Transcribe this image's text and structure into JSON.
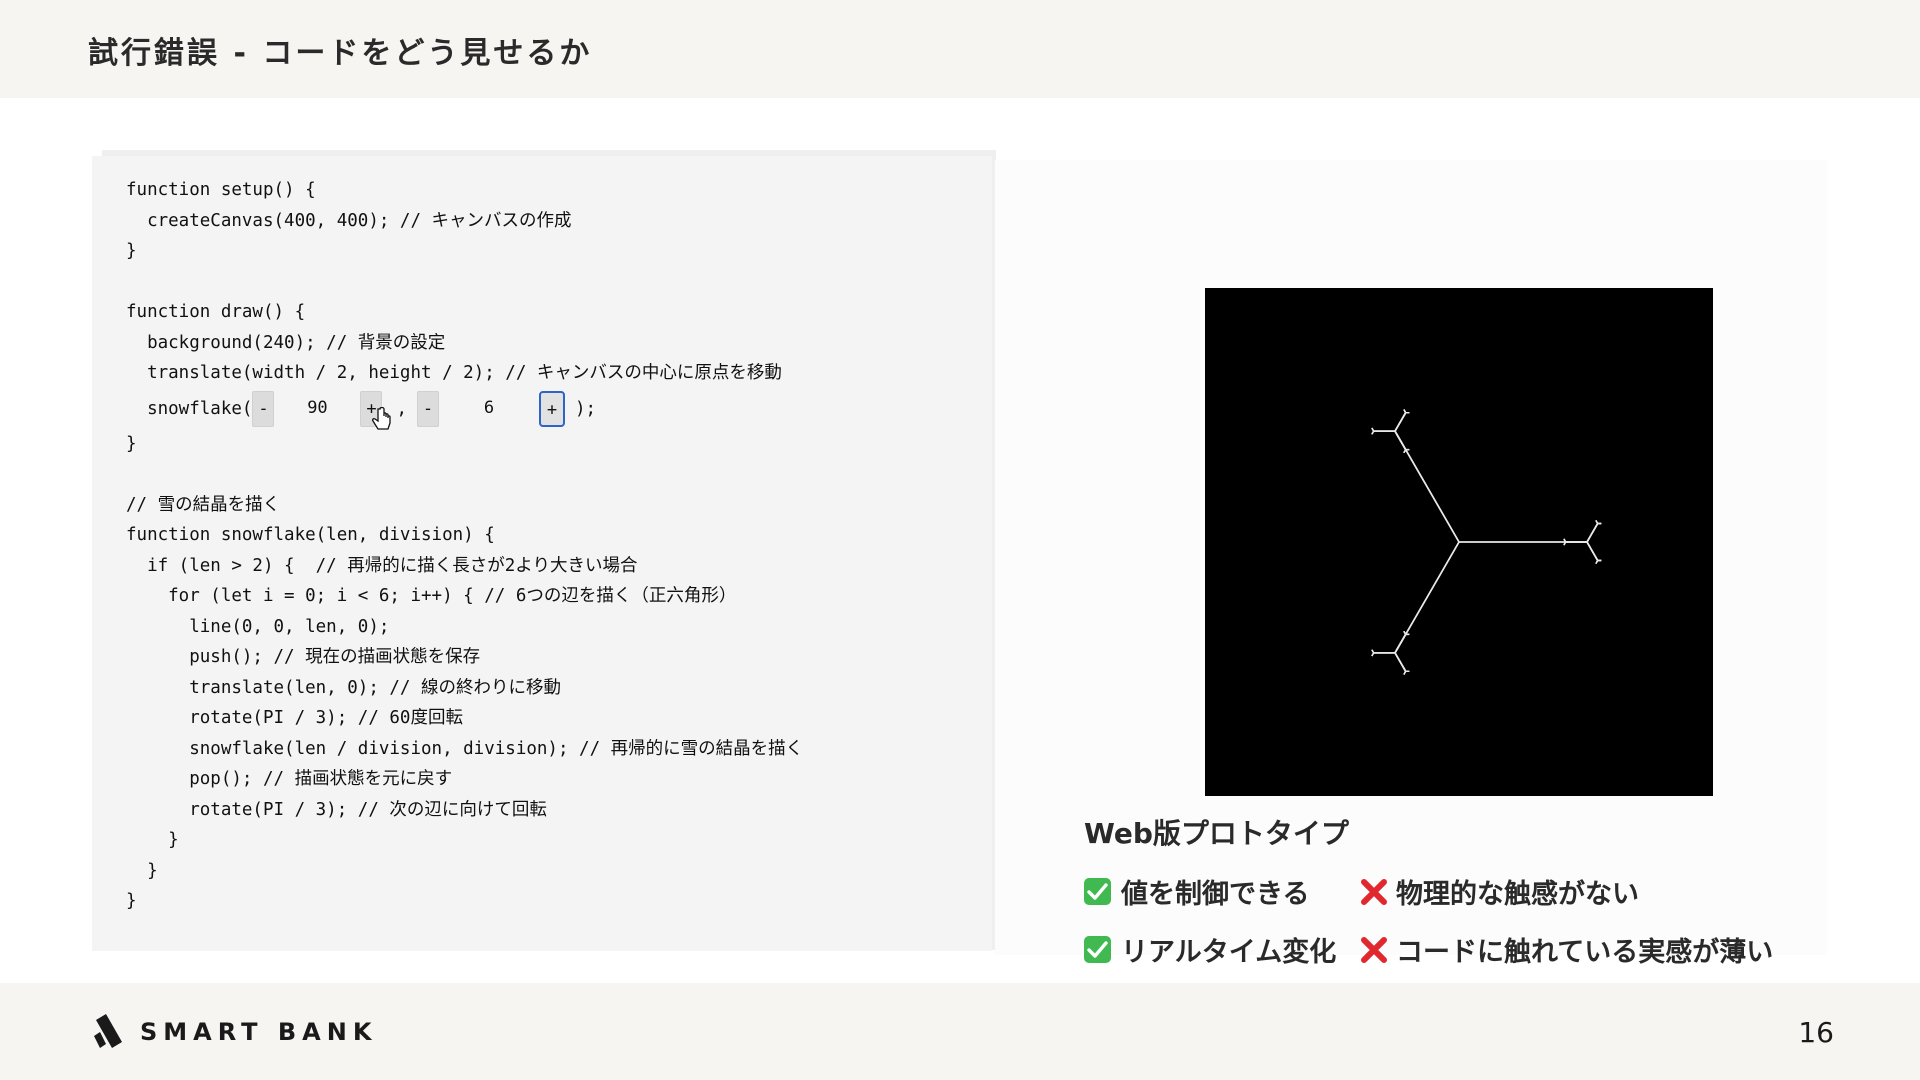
{
  "slide": {
    "title": "試行錯誤 - コードをどう見せるか",
    "page_number": "16"
  },
  "brand": {
    "logo_text": "SMART BANK"
  },
  "code": {
    "lines": [
      "function setup() {",
      "  createCanvas(400, 400); // キャンバスの作成",
      "}",
      "",
      "function draw() {",
      "  background(240); // 背景の設定",
      "  translate(width / 2, height / 2); // キャンバスの中心に原点を移動"
    ],
    "snowflake_call": {
      "prefix": "  snowflake(",
      "separator": ",",
      "suffix": ");",
      "minus_label": "-",
      "plus_label": "+",
      "len_value": "90",
      "division_value": "6"
    },
    "lines_after": [
      "}",
      "",
      "// 雪の結晶を描く",
      "function snowflake(len, division) {",
      "  if (len > 2) {  // 再帰的に描く長さが2より大きい場合",
      "    for (let i = 0; i < 6; i++) { // 6つの辺を描く（正六角形）",
      "      line(0, 0, len, 0);",
      "      push(); // 現在の描画状態を保存",
      "      translate(len, 0); // 線の終わりに移動",
      "      rotate(PI / 3); // 60度回転",
      "      snowflake(len / division, division); // 再帰的に雪の結晶を描く",
      "      pop(); // 描画状態を元に戻す",
      "      rotate(PI / 3); // 次の辺に向けて回転",
      "    }",
      "  }",
      "}"
    ]
  },
  "preview": {
    "caption": "Web版プロトタイプ",
    "pros": [
      "値を制御できる",
      "リアルタイム変化"
    ],
    "cons": [
      "物理的な触感がない",
      "コードに触れている実感が薄い"
    ],
    "icons": {
      "pro": "check-mark-icon",
      "con": "cross-mark-icon"
    },
    "colors": {
      "check": "#3fb950",
      "cross": "#e0282e",
      "focus": "#2f63c7"
    }
  }
}
